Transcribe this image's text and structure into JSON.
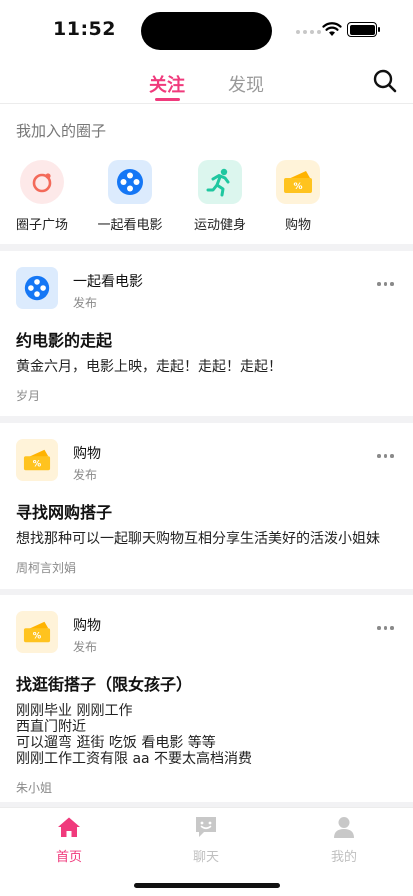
{
  "status": {
    "time": "11:52"
  },
  "nav": {
    "tabs": [
      {
        "label": "关注",
        "active": true
      },
      {
        "label": "发现",
        "active": false
      }
    ],
    "search_icon": "search-icon"
  },
  "my_circles": {
    "title": "我加入的圈子",
    "items": [
      {
        "label": "圈子广场",
        "icon": "circle-square-icon"
      },
      {
        "label": "一起看电影",
        "icon": "film-reel-icon"
      },
      {
        "label": "运动健身",
        "icon": "running-person-icon"
      },
      {
        "label": "购物",
        "icon": "shopping-ticket-icon"
      }
    ]
  },
  "posts": [
    {
      "circle": "一起看电影",
      "action": "发布",
      "icon": "film-reel-icon",
      "title": "约电影的走起",
      "body": "黄金六月，电影上映，走起！走起！走起！",
      "author": "岁月"
    },
    {
      "circle": "购物",
      "action": "发布",
      "icon": "shopping-ticket-icon",
      "title": "寻找网购搭子",
      "body": "想找那种可以一起聊天购物互相分享生活美好的活泼小姐妹",
      "author": "周柯言刘娟"
    },
    {
      "circle": "购物",
      "action": "发布",
      "icon": "shopping-ticket-icon",
      "title": "找逛街搭子（限女孩子）",
      "body": "刚刚毕业 刚刚工作\n西直门附近\n可以遛弯 逛街 吃饭 看电影 等等\n刚刚工作工资有限 aa 不要太高档消费",
      "author": "朱小姐"
    }
  ],
  "tab_bar": {
    "items": [
      {
        "label": "首页",
        "icon": "home-icon",
        "active": true
      },
      {
        "label": "聊天",
        "icon": "chat-icon",
        "active": false
      },
      {
        "label": "我的",
        "icon": "profile-icon",
        "active": false
      }
    ]
  },
  "colors": {
    "accent": "#f03a7c",
    "film_blue": "#1577f5",
    "fitness_teal": "#1fc7a0",
    "shopping_yellow": "#ffc31f"
  }
}
